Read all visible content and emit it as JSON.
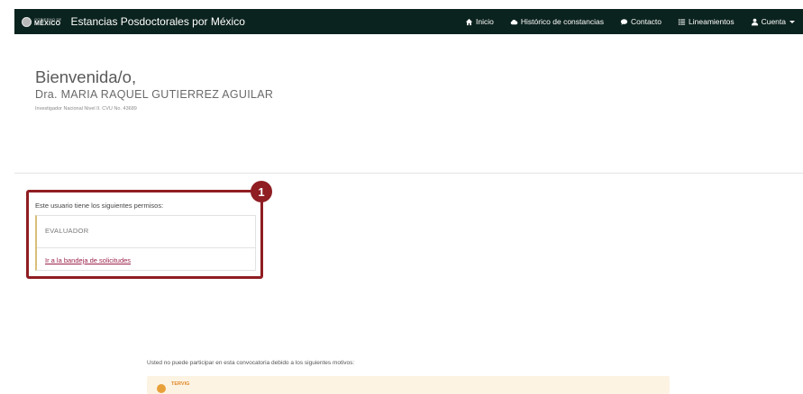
{
  "header": {
    "logo": {
      "small_text": "GOBIERNO DE",
      "big_text": "MÉXICO"
    },
    "title": "Estancias Posdoctorales por México",
    "nav": [
      {
        "label": "Inicio",
        "icon": "home-icon"
      },
      {
        "label": "Histórico de constancias",
        "icon": "cloud-icon"
      },
      {
        "label": "Contacto",
        "icon": "chat-icon"
      },
      {
        "label": "Lineamientos",
        "icon": "list-icon"
      },
      {
        "label": "Cuenta",
        "icon": "user-icon"
      }
    ]
  },
  "welcome": {
    "greeting": "Bienvenida/o,",
    "name": "Dra. MARIA RAQUEL GUTIERREZ AGUILAR",
    "detail": "Investigador Nacional Nivel II. CVU No. 43689"
  },
  "permissions": {
    "title": "Este usuario tiene los siguientes permisos:",
    "role": "EVALUADOR",
    "link": "Ir a la bandeja de solicitudes",
    "badge": "1"
  },
  "notice": {
    "text": "Usted no puede participar en esta convocatoria debido a los siguientes motivos:",
    "code": "TERVIG"
  },
  "colors": {
    "navbar": "#0b231e",
    "accent": "#8f1d22",
    "link": "#9b2249",
    "card_border": "#d9bf7a",
    "notice_bg": "#fdf3e3",
    "notice_accent": "#e08a2a"
  }
}
